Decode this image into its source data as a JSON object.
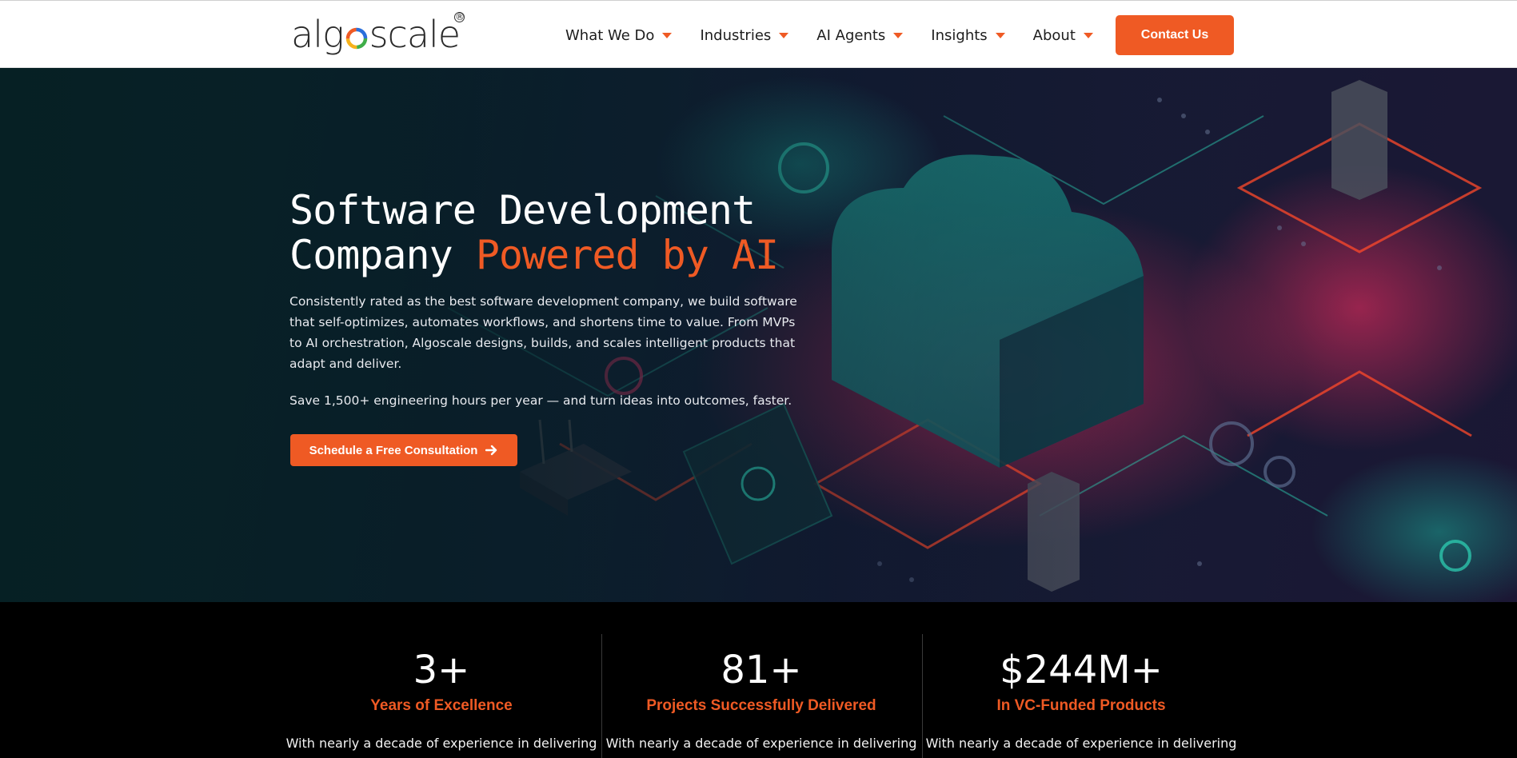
{
  "brand": {
    "logo_text_before": "alg",
    "logo_text_after": "scale",
    "logo_mark": "®"
  },
  "nav": {
    "items": [
      {
        "label": "What We Do",
        "icon": "caret-down-icon"
      },
      {
        "label": "Industries",
        "icon": "caret-down-icon"
      },
      {
        "label": "AI Agents",
        "icon": "caret-down-icon"
      },
      {
        "label": "Insights",
        "icon": "caret-down-icon"
      },
      {
        "label": "About",
        "icon": "caret-down-icon"
      }
    ],
    "contact_label": "Contact Us"
  },
  "hero": {
    "title_line1": "Software Development",
    "title_line2_plain": "Company ",
    "title_line2_accent": "Powered by AI",
    "description": "Consistently rated as the best software development company, we build software that self-optimizes, automates workflows, and shortens time to value. From MVPs to AI orchestration, Algoscale designs, builds, and scales intelligent products that adapt and deliver.",
    "save_text": "Save 1,500+ engineering hours per year — and turn ideas into outcomes, faster.",
    "cta_label": "Schedule a Free Consultation",
    "cta_icon": "arrow-right-icon"
  },
  "stats": [
    {
      "value": "3+",
      "label": "Years of Excellence",
      "text": "With nearly a decade of experience in delivering"
    },
    {
      "value": "81+",
      "label": "Projects Successfully Delivered",
      "text": "With nearly a decade of experience in delivering"
    },
    {
      "value": "$244M+",
      "label": "In VC-Funded Products",
      "text": "With nearly a decade of experience in delivering"
    }
  ],
  "colors": {
    "accent": "#ef5a24",
    "header_bg": "#ffffff",
    "stats_bg": "#000000",
    "hero_bg": "#0d2c36"
  }
}
